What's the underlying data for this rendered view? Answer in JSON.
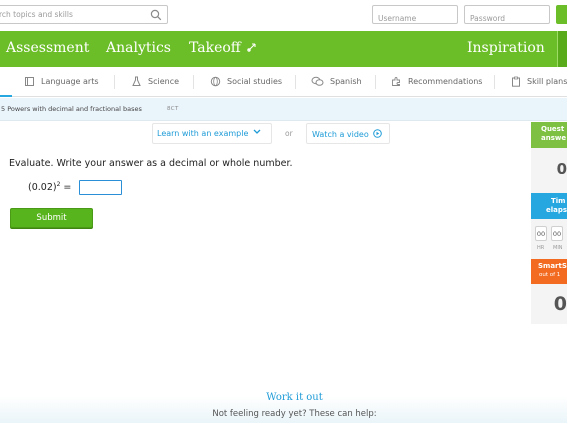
{
  "search": {
    "placeholder": "rch topics and skills"
  },
  "login": {
    "username_placeholder": "Username",
    "password_placeholder": "Password"
  },
  "main_nav": {
    "items": [
      {
        "label": "Assessment"
      },
      {
        "label": "Analytics"
      },
      {
        "label": "Takeoff"
      },
      {
        "label": "Inspiration"
      }
    ]
  },
  "subject_nav": {
    "items": [
      {
        "label": "Language arts",
        "icon": "book-icon"
      },
      {
        "label": "Science",
        "icon": "flask-icon"
      },
      {
        "label": "Social studies",
        "icon": "globe-icon"
      },
      {
        "label": "Spanish",
        "icon": "speech-icon"
      },
      {
        "label": "Recommendations",
        "icon": "puzzle-icon"
      },
      {
        "label": "Skill plans",
        "icon": "clipboard-icon"
      }
    ]
  },
  "breadcrumb": {
    "skill_name": "5 Powers with decimal and fractional bases",
    "skill_code": "8CT"
  },
  "helpers": {
    "example_label": "Learn with an example",
    "or_label": "or",
    "video_label": "Watch a video"
  },
  "question": {
    "prompt": "Evaluate. Write your answer as a decimal or whole number.",
    "base": "(0.02)",
    "exponent": "2",
    "equals": " =",
    "answer_value": ""
  },
  "submit": {
    "label": "Submit"
  },
  "sidebar": {
    "questions_label_1": "Quest",
    "questions_label_2": "answe",
    "questions_count": "0",
    "time_label_1": "Tim",
    "time_label_2": "elaps",
    "clock": {
      "hr": "00",
      "min": "00",
      "hr_unit": "HR",
      "min_unit": "MIN"
    },
    "smartscore_label_1": "SmartS",
    "smartscore_label_2": "out of 1",
    "smartscore": "0"
  },
  "bottom": {
    "work_it_out": "Work it out",
    "not_ready": "Not feeling ready yet? These can help:"
  },
  "colors": {
    "brand_green": "#6cbe28",
    "link_blue": "#1e9bd7",
    "orange": "#f26b21",
    "time_blue": "#27a7e0"
  }
}
